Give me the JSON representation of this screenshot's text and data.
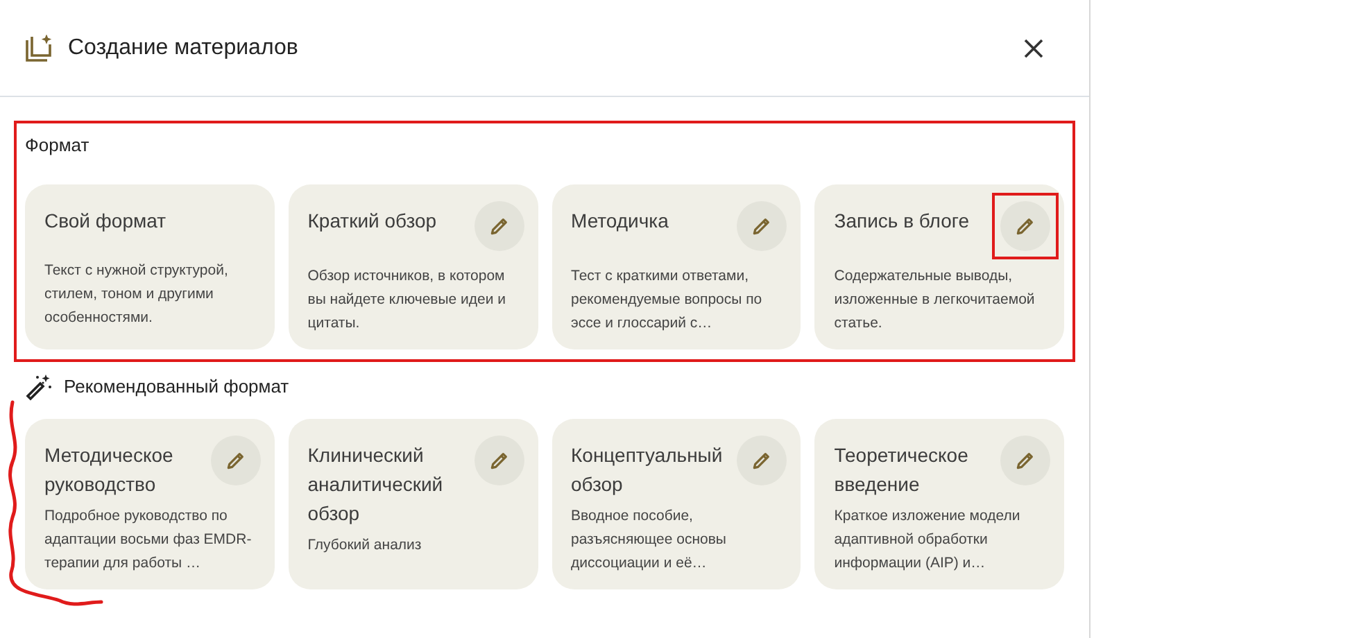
{
  "dialog": {
    "title": "Создание материалов"
  },
  "format_section": {
    "heading": "Формат",
    "cards": [
      {
        "title": "Свой формат",
        "description": "Текст с нужной структурой, стилем, тоном и другими особенностями.",
        "editable": false,
        "highlighted": false
      },
      {
        "title": "Краткий обзор",
        "description": "Обзор источников, в котором вы найдете ключевые идеи и цитаты.",
        "editable": true,
        "highlighted": false
      },
      {
        "title": "Методичка",
        "description": "Тест с краткими ответами, рекомендуемые вопросы по эссе и глоссарий с…",
        "editable": true,
        "highlighted": false
      },
      {
        "title": "Запись в блоге",
        "description": "Содержательные выводы, изложенные в легкочитаемой статье.",
        "editable": true,
        "highlighted": true
      }
    ]
  },
  "recommended_section": {
    "heading": "Рекомендованный формат",
    "cards": [
      {
        "title": "Методическое руководство",
        "description": "Подробное руководство по адаптации восьми фаз EMDR-терапии для работы …",
        "editable": true,
        "highlighted": false
      },
      {
        "title": "Клинический аналитический обзор",
        "description": "Глубокий анализ",
        "editable": true,
        "highlighted": false
      },
      {
        "title": "Концептуальный обзор",
        "description": "Вводное пособие, разъясняющее основы диссоциации и её…",
        "editable": true,
        "highlighted": false
      },
      {
        "title": "Теоретическое введение",
        "description": "Краткое изложение модели адаптивной обработки информации (AIP) и…",
        "editable": true,
        "highlighted": false
      }
    ]
  }
}
